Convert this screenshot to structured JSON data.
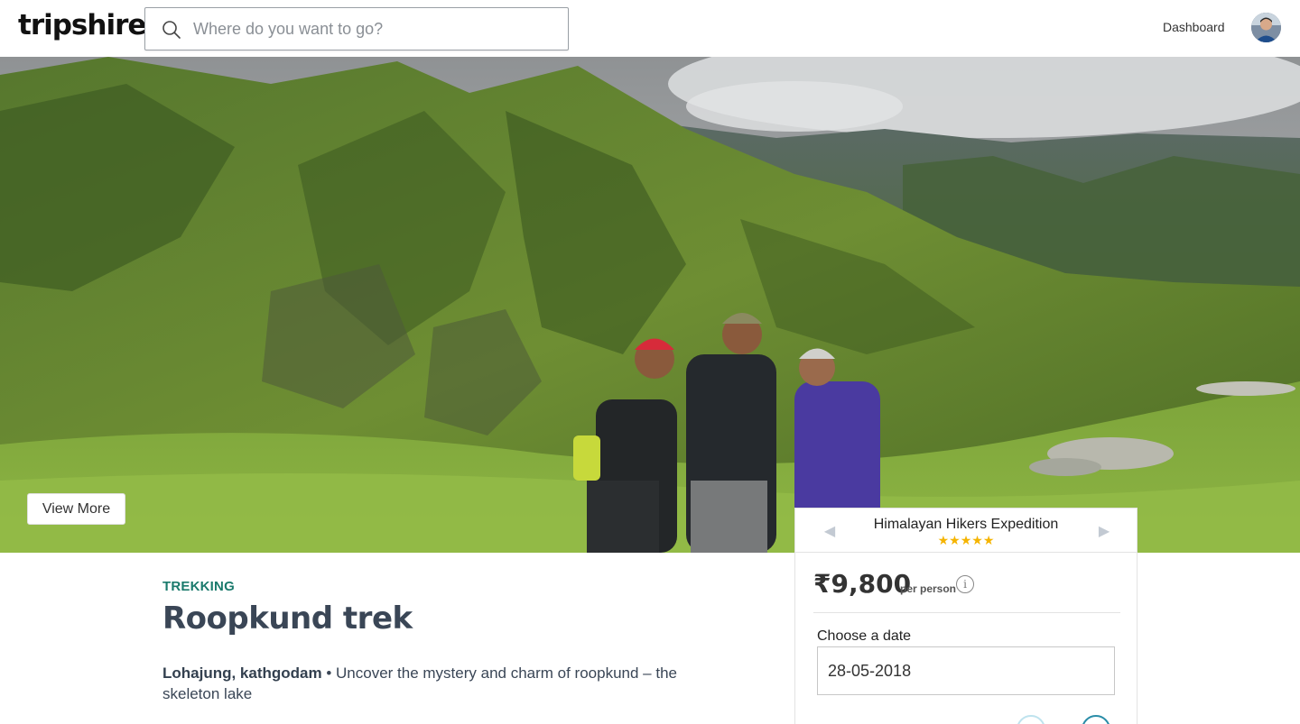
{
  "header": {
    "logo_text": "tripshire",
    "search_placeholder": "Where do you want to go?",
    "nav_dashboard": "Dashboard"
  },
  "hero": {
    "view_more_label": "View More"
  },
  "trip": {
    "category": "TREKKING",
    "title": "Roopkund trek",
    "location": "Lohajung, kathgodam",
    "separator": " • ",
    "description": "Uncover the mystery and charm of roopkund – the skeleton lake"
  },
  "booking": {
    "operator": "Himalayan Hikers Expedition",
    "rating": 5,
    "stars": "★★★★★",
    "price": "₹9,800",
    "price_unit": "per person",
    "info_icon": "i",
    "choose_date_label": "Choose a date",
    "date_value": "28-05-2018",
    "arrow_left": "◀",
    "arrow_right": "▶"
  },
  "colors": {
    "category_teal": "#1a7a6c",
    "star_gold": "#f5b400",
    "title_slate": "#3a4656",
    "circle_button_blue": "#2a8da8"
  },
  "icons": {
    "search": "search-icon",
    "info": "info-icon",
    "avatar": "user-avatar",
    "prev": "chevron-left-icon",
    "next": "chevron-right-icon"
  }
}
